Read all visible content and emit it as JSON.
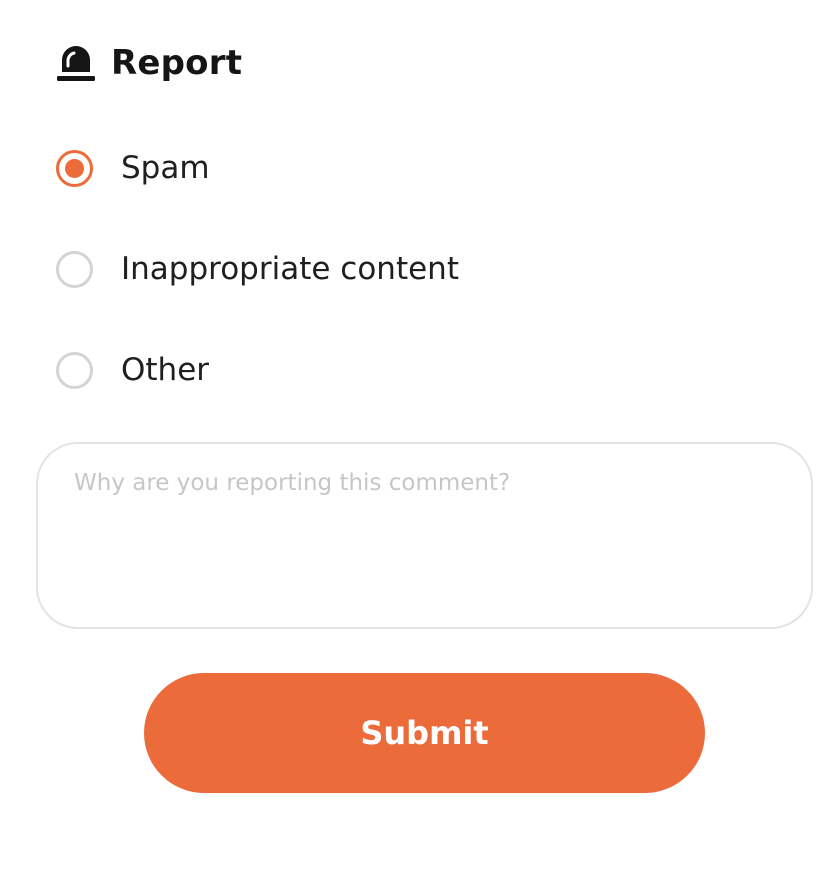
{
  "header": {
    "icon": "alarm-siren-icon",
    "title": "Report"
  },
  "options": [
    {
      "label": "Spam",
      "checked": true
    },
    {
      "label": "Inappropriate content",
      "checked": false
    },
    {
      "label": "Other",
      "checked": false
    }
  ],
  "reason_field": {
    "placeholder": "Why are you reporting this comment?",
    "value": ""
  },
  "submit": {
    "label": "Submit"
  },
  "colors": {
    "accent": "#ec6b3b",
    "radio_border": "#d4d4d4",
    "field_border": "#e3e3e3"
  }
}
